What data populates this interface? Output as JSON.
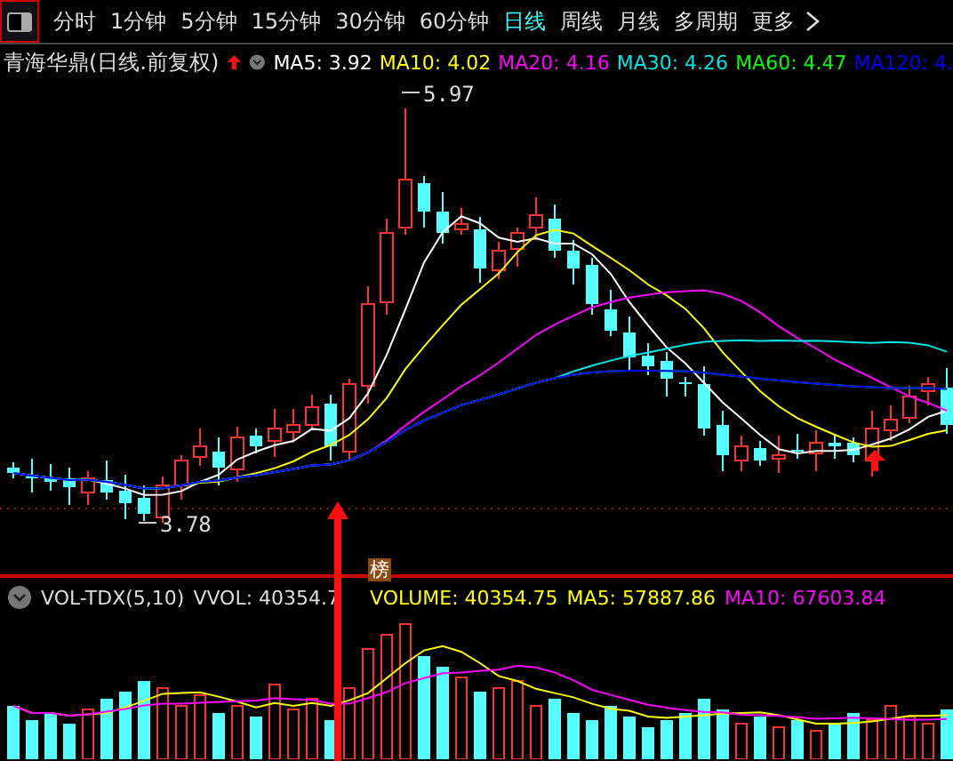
{
  "toolbar": {
    "tabs": [
      {
        "label": "分时",
        "selected": false
      },
      {
        "label": "1分钟",
        "selected": false
      },
      {
        "label": "5分钟",
        "selected": false
      },
      {
        "label": "15分钟",
        "selected": false
      },
      {
        "label": "30分钟",
        "selected": false
      },
      {
        "label": "60分钟",
        "selected": false
      },
      {
        "label": "日线",
        "selected": true
      },
      {
        "label": "周线",
        "selected": false
      },
      {
        "label": "月线",
        "selected": false
      },
      {
        "label": "多周期",
        "selected": false
      }
    ],
    "more": "更多"
  },
  "price_panel": {
    "title": "青海华鼎(日线.前复权)",
    "indicators": [
      {
        "label": "MA5: 3.92",
        "color": "#ffffff"
      },
      {
        "label": "MA10: 4.02",
        "color": "#ffff00"
      },
      {
        "label": "MA20: 4.16",
        "color": "#ff00ff"
      },
      {
        "label": "MA30: 4.26",
        "color": "#00e5e5"
      },
      {
        "label": "MA60: 4.47",
        "color": "#00ff00"
      },
      {
        "label": "MA120: 4.",
        "color": "#0000ff"
      }
    ],
    "high_label": "5.97",
    "low_label": "3.78",
    "badge": "榜"
  },
  "volume_panel": {
    "title": "VOL-TDX(5,10)",
    "vvol": "VVOL: 40354.7",
    "indicators": [
      {
        "label": "VOLUME: 40354.75",
        "color": "#ffff00"
      },
      {
        "label": "MA5: 57887.86",
        "color": "#ffff00"
      },
      {
        "label": "MA10: 67603.84",
        "color": "#ff00ff"
      }
    ]
  }
}
